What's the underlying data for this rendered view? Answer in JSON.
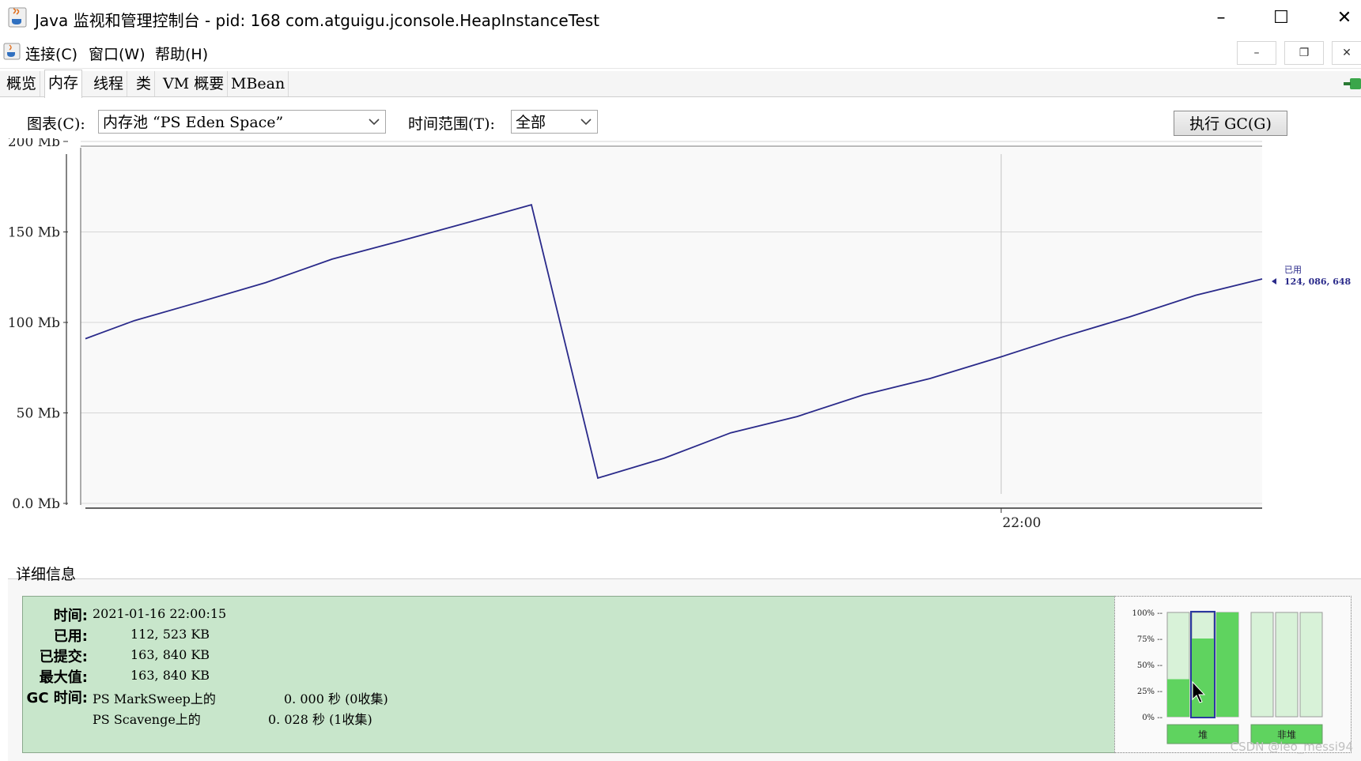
{
  "window": {
    "title": "Java 监视和管理控制台 - pid: 168 com.atguigu.jconsole.HeapInstanceTest",
    "minimize": "–",
    "maximize": "☐",
    "close": "✕"
  },
  "menu": {
    "items": [
      "连接(C)",
      "窗口(W)",
      "帮助(H)"
    ],
    "inner_min": "–",
    "inner_restore": "❐",
    "inner_close": "✕"
  },
  "tabs": [
    {
      "label": "概览"
    },
    {
      "label": "内存",
      "active": true
    },
    {
      "label": "线程"
    },
    {
      "label": "类"
    },
    {
      "label": "VM 概要"
    },
    {
      "label": "MBean"
    }
  ],
  "controls": {
    "chart_label": "图表(C):",
    "chart_value": "内存池 “PS Eden Space”",
    "range_label": "时间范围(T):",
    "range_value": "全部",
    "gc_button": "执行 GC(G)"
  },
  "chart_data": {
    "type": "line",
    "y_ticks": [
      "200 Mb",
      "150 Mb",
      "100 Mb",
      "50 Mb",
      "0.0 Mb"
    ],
    "ylim": [
      0,
      200
    ],
    "x_tick_label": "22:00",
    "grid": true,
    "series": [
      {
        "values": [
          91,
          101,
          111,
          122,
          135,
          145,
          155,
          165,
          14,
          25,
          39,
          48,
          60,
          69,
          81,
          92,
          103,
          115,
          124
        ]
      }
    ],
    "line_color": "#2a2a8a",
    "annotation_label": "已用",
    "annotation_value": "124, 086, 648"
  },
  "details": {
    "title": "详细信息",
    "time_label": "时间:",
    "time_value": "2021-01-16 22:00:15",
    "used_label": "已用:",
    "used_value": "112, 523 KB",
    "committed_label": "已提交:",
    "committed_value": "163, 840 KB",
    "max_label": "最大值:",
    "max_value": "163, 840 KB",
    "gc_label": "GC 时间:",
    "gc1_name": "PS MarkSweep上的",
    "gc1_value": "0. 000  秒 (0收集)",
    "gc2_name": "PS Scavenge上的",
    "gc2_value": "0. 028  秒 (1收集)",
    "panel_color": "#c8e6cb"
  },
  "gauges": {
    "ticks": [
      "100% --",
      "75% --",
      "50% --",
      "25% --",
      "0% --"
    ],
    "heap_label": "堆",
    "nonheap_label": "非堆",
    "heap_levels": [
      0.36,
      0.75,
      1.0
    ],
    "nonheap_levels": [
      0.0,
      0.0,
      0.0
    ],
    "colors": {
      "fill": "#5fd35f",
      "empty": "#d8f2d8"
    }
  },
  "watermark": "CSDN @leo_messi94"
}
